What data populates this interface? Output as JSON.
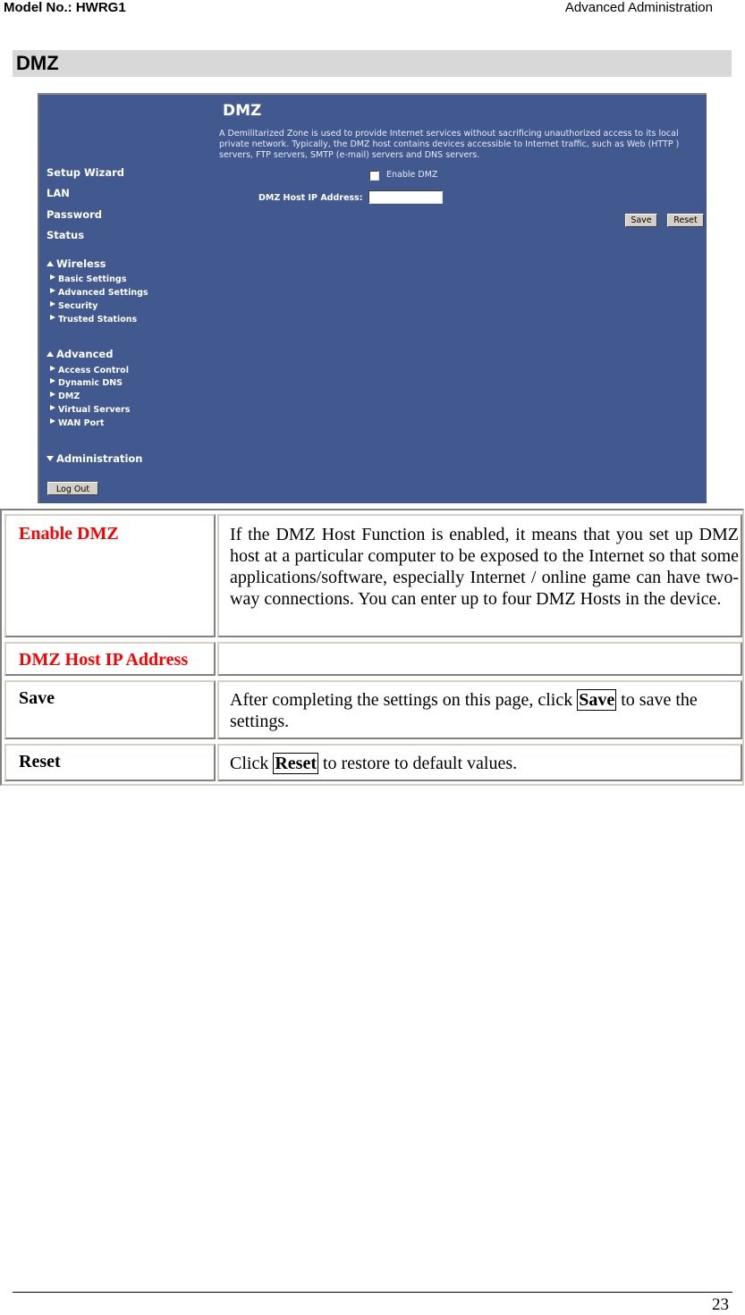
{
  "header": {
    "model": "Model No.: HWRG1",
    "chapter": "Advanced Administration"
  },
  "section_title": "DMZ",
  "screenshot": {
    "title": "DMZ",
    "description": "A Demilitarized Zone is used to provide Internet services without sacrificing unauthorized access to its local private network. Typically, the DMZ host contains devices accessible to Internet traffic, such as Web (HTTP ) servers, FTP servers, SMTP (e-mail) servers and DNS servers.",
    "colors": {
      "background": "#41598f",
      "text": "#ffffff"
    },
    "nav": {
      "main": [
        "Setup Wizard",
        "LAN",
        "Password",
        "Status"
      ],
      "wireless": {
        "label": "Wireless",
        "state": "expanded",
        "items": [
          "Basic Settings",
          "Advanced Settings",
          "Security",
          "Trusted Stations"
        ]
      },
      "advanced": {
        "label": "Advanced",
        "state": "expanded",
        "items": [
          "Access Control",
          "Dynamic DNS",
          "DMZ",
          "Virtual Servers",
          "WAN Port"
        ]
      },
      "administration": {
        "label": "Administration",
        "state": "collapsed"
      },
      "logout_label": "Log Out"
    },
    "form": {
      "enable_dmz_label": "Enable DMZ",
      "enable_dmz_checked": false,
      "host_ip_label": "DMZ Host IP Address:",
      "host_ip_value": "",
      "save_label": "Save",
      "reset_label": "Reset"
    }
  },
  "table": {
    "rows": [
      {
        "term": "Enable DMZ",
        "highlight": true,
        "definition": "If the DMZ Host Function is enabled, it means that you set up DMZ host at a particular computer to be exposed to the Internet so that some applications/software, especially Internet / online game can have two-way connections. You can enter up to four DMZ Hosts in the device."
      },
      {
        "term": "DMZ Host IP Address",
        "highlight": true,
        "definition": ""
      },
      {
        "term": "Save",
        "highlight": false,
        "definition_pre": "After completing the settings on this page, click ",
        "definition_key": "Save",
        "definition_post": " to save the settings."
      },
      {
        "term": "Reset",
        "highlight": false,
        "definition_pre": "Click ",
        "definition_key": "Reset",
        "definition_post": " to restore to default values."
      }
    ],
    "highlight_color": "#ff0000"
  },
  "footer": {
    "page_number": "23"
  }
}
